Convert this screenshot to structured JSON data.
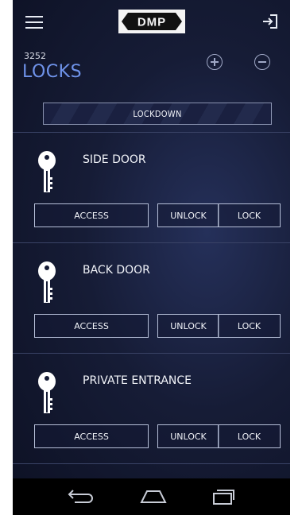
{
  "header": {
    "menu_icon": "hamburger-menu-icon",
    "logo_icon": "dmp-logo",
    "logout_icon": "logout-icon"
  },
  "account": {
    "number": "3252",
    "title": "LOCKS"
  },
  "actions": {
    "add_icon": "plus-circle-icon",
    "remove_icon": "minus-circle-icon"
  },
  "lockdown_label": "LOCKDOWN",
  "locks": [
    {
      "name": "SIDE DOOR",
      "access_label": "ACCESS",
      "unlock_label": "UNLOCK",
      "lock_label": "LOCK"
    },
    {
      "name": "BACK DOOR",
      "access_label": "ACCESS",
      "unlock_label": "UNLOCK",
      "lock_label": "LOCK"
    },
    {
      "name": "PRIVATE ENTRANCE",
      "access_label": "ACCESS",
      "unlock_label": "UNLOCK",
      "lock_label": "LOCK"
    }
  ],
  "navbar": {
    "back_icon": "back-icon",
    "home_icon": "home-icon",
    "recents_icon": "recents-icon"
  },
  "colors": {
    "accent": "#6f93ea",
    "background": "#161c36",
    "button_border": "#b6bfd8"
  }
}
